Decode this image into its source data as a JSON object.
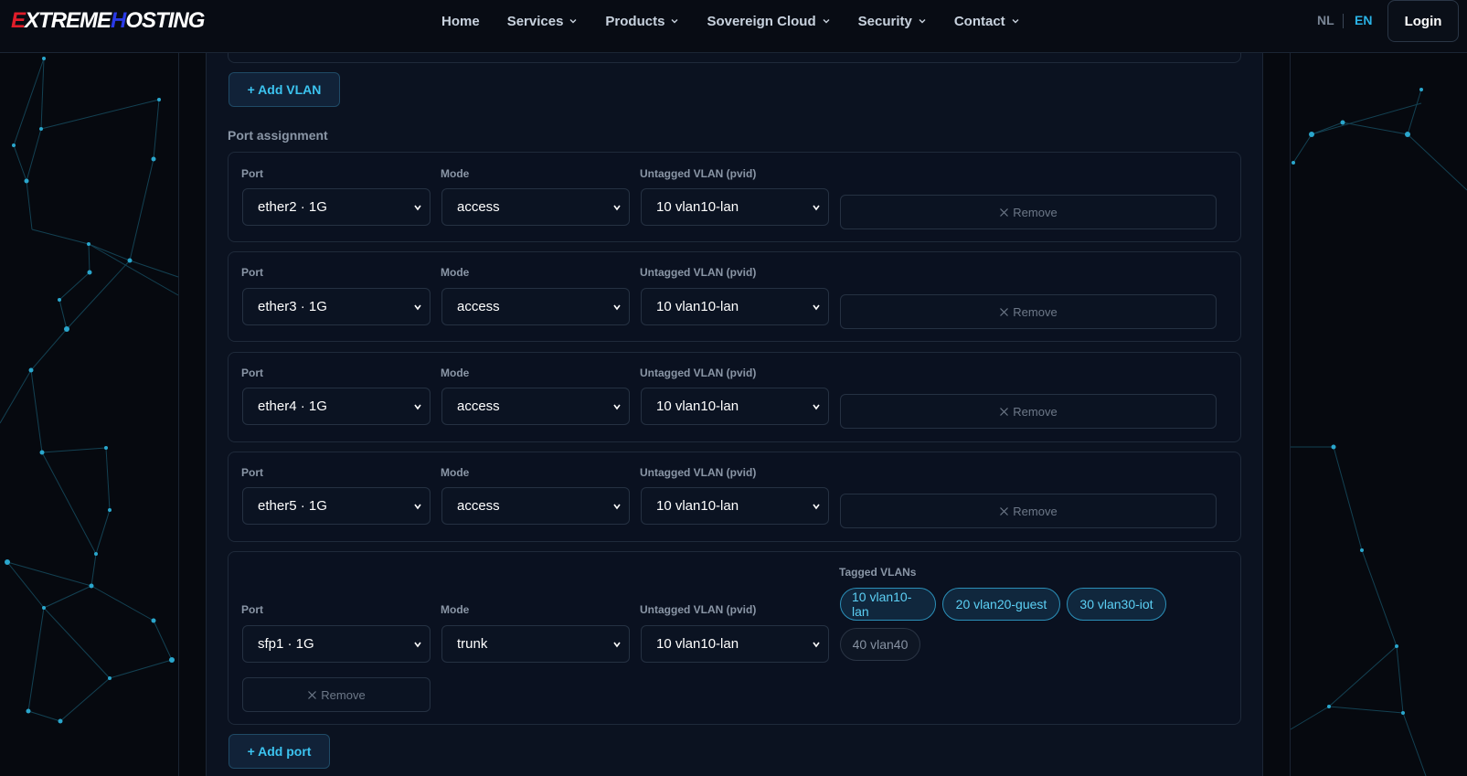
{
  "brand": {
    "logo_parts": [
      "E",
      "X",
      "TREME",
      "H",
      "OSTING"
    ]
  },
  "nav": {
    "items": [
      {
        "label": "Home",
        "has_dropdown": false
      },
      {
        "label": "Services",
        "has_dropdown": true
      },
      {
        "label": "Products",
        "has_dropdown": true
      },
      {
        "label": "Sovereign Cloud",
        "has_dropdown": true
      },
      {
        "label": "Security",
        "has_dropdown": true
      },
      {
        "label": "Contact",
        "has_dropdown": true
      }
    ],
    "lang_nl": "NL",
    "lang_en": "EN",
    "active_lang": "EN",
    "login_label": "Login"
  },
  "vlan_section": {
    "add_vlan_label": "+ Add VLAN"
  },
  "port_assignment": {
    "title": "Port assignment",
    "labels": {
      "port": "Port",
      "mode": "Mode",
      "pvid": "Untagged VLAN (pvid)",
      "tagged": "Tagged VLANs"
    },
    "remove_label": "Remove",
    "ports": [
      {
        "port": "ether2 · 1G",
        "mode": "access",
        "pvid": "10 vlan10-lan"
      },
      {
        "port": "ether3 · 1G",
        "mode": "access",
        "pvid": "10 vlan10-lan"
      },
      {
        "port": "ether4 · 1G",
        "mode": "access",
        "pvid": "10 vlan10-lan"
      },
      {
        "port": "ether5 · 1G",
        "mode": "access",
        "pvid": "10 vlan10-lan"
      },
      {
        "port": "sfp1 · 1G",
        "mode": "trunk",
        "pvid": "10 vlan10-lan",
        "tagged_vlans": [
          {
            "label": "10 vlan10-lan",
            "selected": true
          },
          {
            "label": "20 vlan20-guest",
            "selected": true
          },
          {
            "label": "30 vlan30-iot",
            "selected": true
          },
          {
            "label": "40 vlan40",
            "selected": false
          }
        ]
      }
    ],
    "add_port_label": "+ Add port"
  },
  "colors": {
    "accent": "#2ab3e6",
    "background": "#06090f",
    "panel": "#0b1220",
    "brand_red": "#e11d2a",
    "brand_blue": "#2a3ae6"
  },
  "icons": [
    "chevron-down-icon",
    "close-icon"
  ]
}
